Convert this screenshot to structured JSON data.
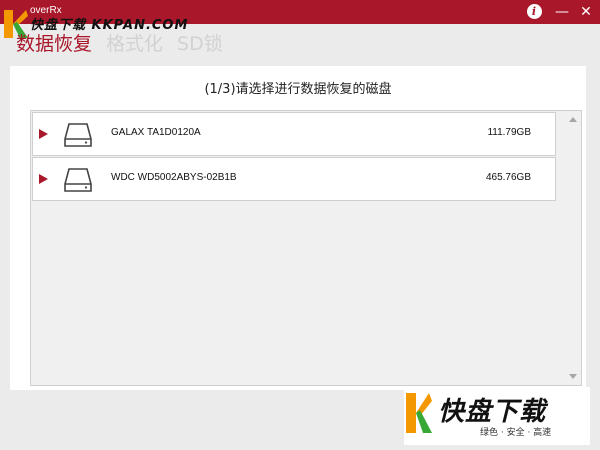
{
  "window": {
    "title": "overRx",
    "info_label": "i",
    "minimize_label": "—",
    "close_label": "✕"
  },
  "watermark_top": {
    "text": "快盘下载 KKPAN.COM"
  },
  "nav": {
    "tabs": [
      {
        "label": "数据恢复",
        "active": true
      },
      {
        "label": "格式化",
        "active": false
      },
      {
        "label": "SD锁",
        "active": false
      }
    ]
  },
  "panel": {
    "title": "(1/3)请选择进行数据恢复的磁盘"
  },
  "disks": [
    {
      "name": "GALAX TA1D0120A",
      "size": "111.79GB",
      "icon": "hard-disk-icon"
    },
    {
      "name": "WDC WD5002ABYS-02B1B",
      "size": "465.76GB",
      "icon": "hard-disk-icon"
    }
  ],
  "watermark_bottom": {
    "big": "快盘下载",
    "small": "绿色 · 安全 · 高速"
  },
  "colors": {
    "accent": "#a8172a",
    "background": "#ebebeb",
    "logo_orange": "#f39800",
    "logo_green": "#37a835"
  }
}
